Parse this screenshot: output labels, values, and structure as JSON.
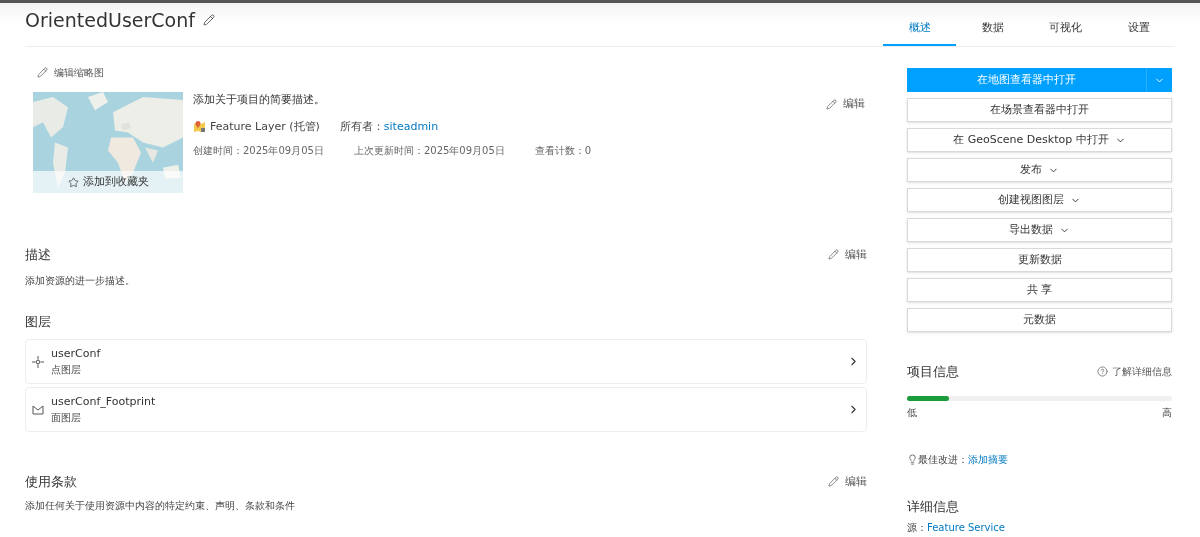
{
  "title": "OrientedUserConf",
  "tabs": [
    {
      "label": "概述",
      "selected": true
    },
    {
      "label": "数据",
      "selected": false
    },
    {
      "label": "可视化",
      "selected": false
    },
    {
      "label": "设置",
      "selected": false
    }
  ],
  "thumbnail": {
    "edit_label": "编辑缩略图",
    "favorite_label": "添加到收藏夹"
  },
  "summary": {
    "text": "添加关于项目的简要描述。",
    "edit_label": "编辑",
    "type": "Feature Layer (托管)",
    "owner_label": "所有者：",
    "owner": "siteadmin",
    "created": "创建时间：2025年09月05日",
    "updated": "上次更新时间：2025年09月05日",
    "views": "查看计数：0"
  },
  "description": {
    "heading": "描述",
    "edit_label": "编辑",
    "text": "添加资源的进一步描述。"
  },
  "layers": {
    "heading": "图层",
    "items": [
      {
        "kind": "point",
        "name": "userConf",
        "type": "点图层"
      },
      {
        "kind": "polygon",
        "name": "userConf_Footprint",
        "type": "面图层"
      }
    ]
  },
  "terms": {
    "heading": "使用条款",
    "edit_label": "编辑",
    "text": "添加任何关于使用资源中内容的特定约束、声明、条款和条件"
  },
  "actions": [
    {
      "label": "在地图查看器中打开",
      "kind": "primary",
      "dropdown": true
    },
    {
      "label": "在场景查看器中打开",
      "kind": "default",
      "dropdown": false
    },
    {
      "label": "在 GeoScene Desktop 中打开",
      "kind": "default",
      "dropdown": true
    },
    {
      "label": "发布",
      "kind": "default",
      "dropdown": true
    },
    {
      "label": "创建视图图层",
      "kind": "default",
      "dropdown": true
    },
    {
      "label": "导出数据",
      "kind": "default",
      "dropdown": true
    },
    {
      "label": "更新数据",
      "kind": "default",
      "dropdown": false
    },
    {
      "label": "共 享",
      "kind": "default",
      "dropdown": false
    },
    {
      "label": "元数据",
      "kind": "default",
      "dropdown": false
    }
  ],
  "item_info": {
    "heading": "项目信息",
    "help_link": "了解详细信息",
    "level": 0.16,
    "low": "低",
    "high": "高",
    "tip_label": "最佳改进：",
    "tip_link": "添加摘要"
  },
  "details": {
    "heading": "详细信息",
    "source_label": "源：",
    "source": "Feature Service"
  }
}
